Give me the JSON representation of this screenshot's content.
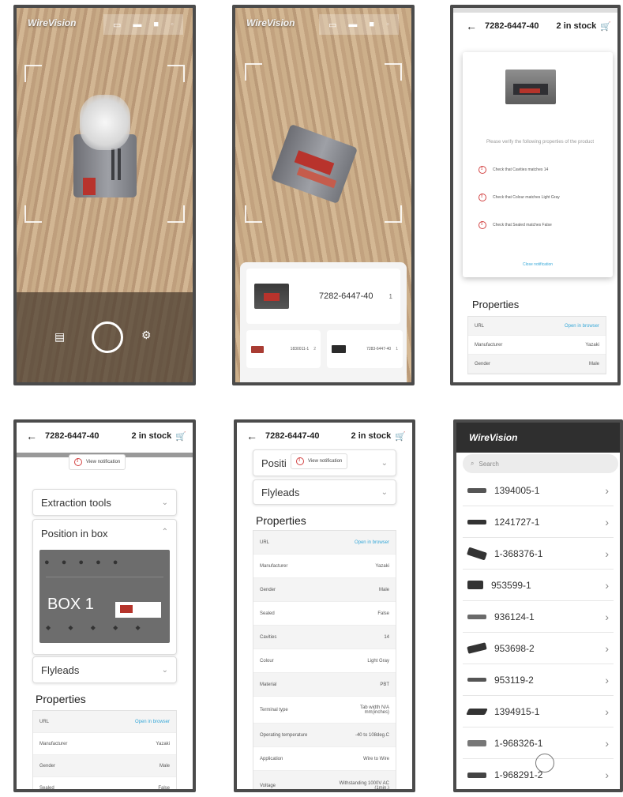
{
  "app_name": "WireVision",
  "part_number": "7282-6447-40",
  "stock_text": "2 in stock",
  "scan_result": {
    "title": "7282-6447-40",
    "count": "1",
    "alternatives": [
      {
        "label": "1830011-1",
        "count": "2"
      },
      {
        "label": "7283-6447-40",
        "count": "1"
      }
    ]
  },
  "verify": {
    "intro": "Please verify the following properties of the product",
    "checks": [
      "Check that Cavities matches 14",
      "Check that Colour matches Light Gray",
      "Check that Sealed matches False"
    ],
    "close": "Close notification"
  },
  "view_notification": "View notification",
  "sections": {
    "extraction": "Extraction tools",
    "position": "Position in box",
    "position_short": "Positi",
    "flyleads": "Flyleads",
    "box_label": "BOX 1"
  },
  "properties_title": "Properties",
  "properties": [
    {
      "name": "URL",
      "value": "Open in browser"
    },
    {
      "name": "Manufacturer",
      "value": "Yazaki"
    },
    {
      "name": "Gender",
      "value": "Male"
    },
    {
      "name": "Sealed",
      "value": "False"
    },
    {
      "name": "Cavities",
      "value": "14"
    },
    {
      "name": "Colour",
      "value": "Light Gray"
    },
    {
      "name": "Material",
      "value": "PBT"
    },
    {
      "name": "Terminal type",
      "value": "Tab width N/A mm(inches)"
    },
    {
      "name": "Operating temperature",
      "value": "-40 to 108deg.C"
    },
    {
      "name": "Application",
      "value": "Wire to Wire"
    },
    {
      "name": "Voltage",
      "value": "Withstanding 1000V AC (1min.)"
    }
  ],
  "search_placeholder": "Search",
  "parts_list": [
    "1394005-1",
    "1241727-1",
    "1-368376-1",
    "953599-1",
    "936124-1",
    "953698-2",
    "953119-2",
    "1394915-1",
    "1-968326-1",
    "1-968291-2"
  ]
}
